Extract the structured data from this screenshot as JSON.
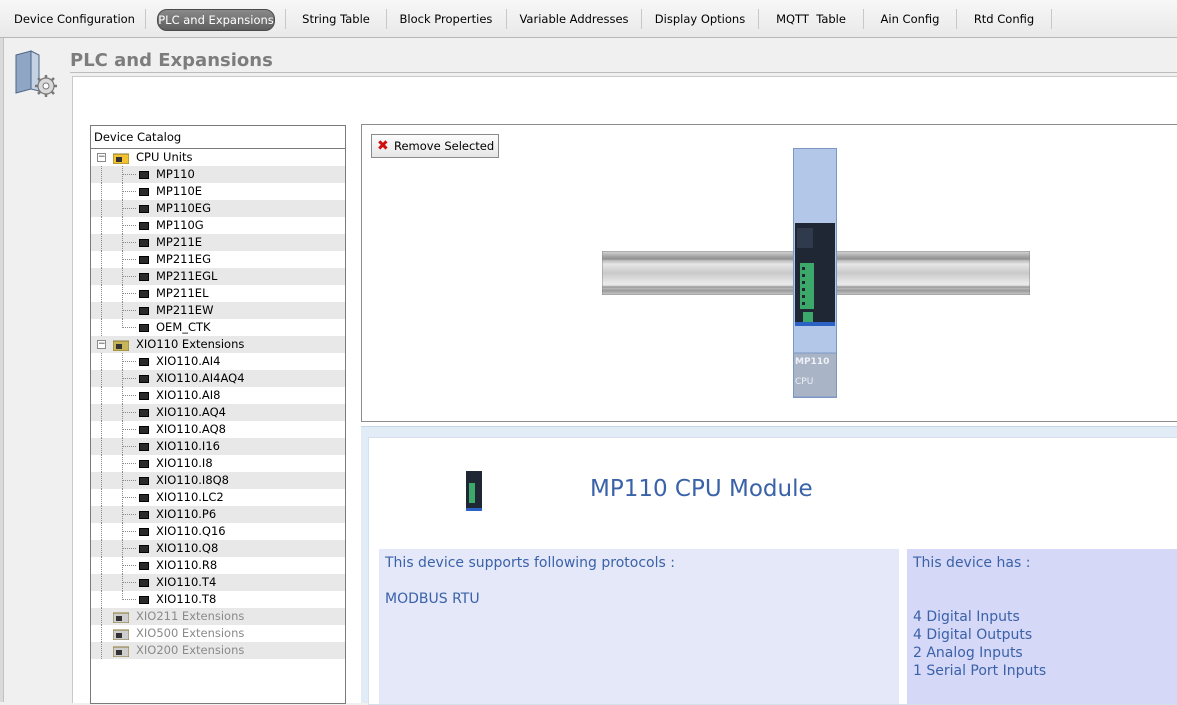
{
  "tabs": [
    {
      "label": "Device Configuration",
      "active": false
    },
    {
      "label": "PLC and Expansions",
      "active": true
    },
    {
      "label": "String Table",
      "active": false
    },
    {
      "label": "Block Properties",
      "active": false
    },
    {
      "label": "Variable Addresses",
      "active": false
    },
    {
      "label": "Display Options",
      "active": false
    },
    {
      "label": "MQTT  Table",
      "active": false
    },
    {
      "label": "Ain Config",
      "active": false
    },
    {
      "label": "Rtd Config",
      "active": false
    }
  ],
  "page": {
    "title": "PLC and Expansions"
  },
  "catalog": {
    "header": "Device Catalog",
    "groups": [
      {
        "label": "CPU Units",
        "expanded": true,
        "items": [
          "MP110",
          "MP110E",
          "MP110EG",
          "MP110G",
          "MP211E",
          "MP211EG",
          "MP211EGL",
          "MP211EL",
          "MP211EW",
          "OEM_CTK"
        ]
      },
      {
        "label": "XIO110 Extensions",
        "expanded": true,
        "items": [
          "XIO110.AI4",
          "XIO110.AI4AQ4",
          "XIO110.AI8",
          "XIO110.AQ4",
          "XIO110.AQ8",
          "XIO110.I16",
          "XIO110.I8",
          "XIO110.I8Q8",
          "XIO110.LC2",
          "XIO110.P6",
          "XIO110.Q16",
          "XIO110.Q8",
          "XIO110.R8",
          "XIO110.T4",
          "XIO110.T8"
        ]
      },
      {
        "label": "XIO211 Extensions",
        "expanded": false,
        "items": []
      },
      {
        "label": "XIO500 Extensions",
        "expanded": false,
        "items": []
      },
      {
        "label": "XIO200 Extensions",
        "expanded": false,
        "items": []
      }
    ]
  },
  "toolbar": {
    "remove_label": "Remove Selected"
  },
  "preview": {
    "module_name": "MP110",
    "module_type": "CPU"
  },
  "detail": {
    "title": "MP110 CPU Module",
    "protocols_heading": "This device supports following protocols :",
    "protocols": [
      "MODBUS RTU"
    ],
    "has_heading": "This device has :",
    "features": [
      "4 Digital Inputs",
      "4 Digital Outputs",
      "2 Analog Inputs",
      "1 Serial Port Inputs"
    ]
  },
  "colors": {
    "accent_text": "#3a62a8",
    "active_tab": "#6b6b6b",
    "protocol_box": "#e5e8f9",
    "has_box": "#d6d8f7"
  }
}
